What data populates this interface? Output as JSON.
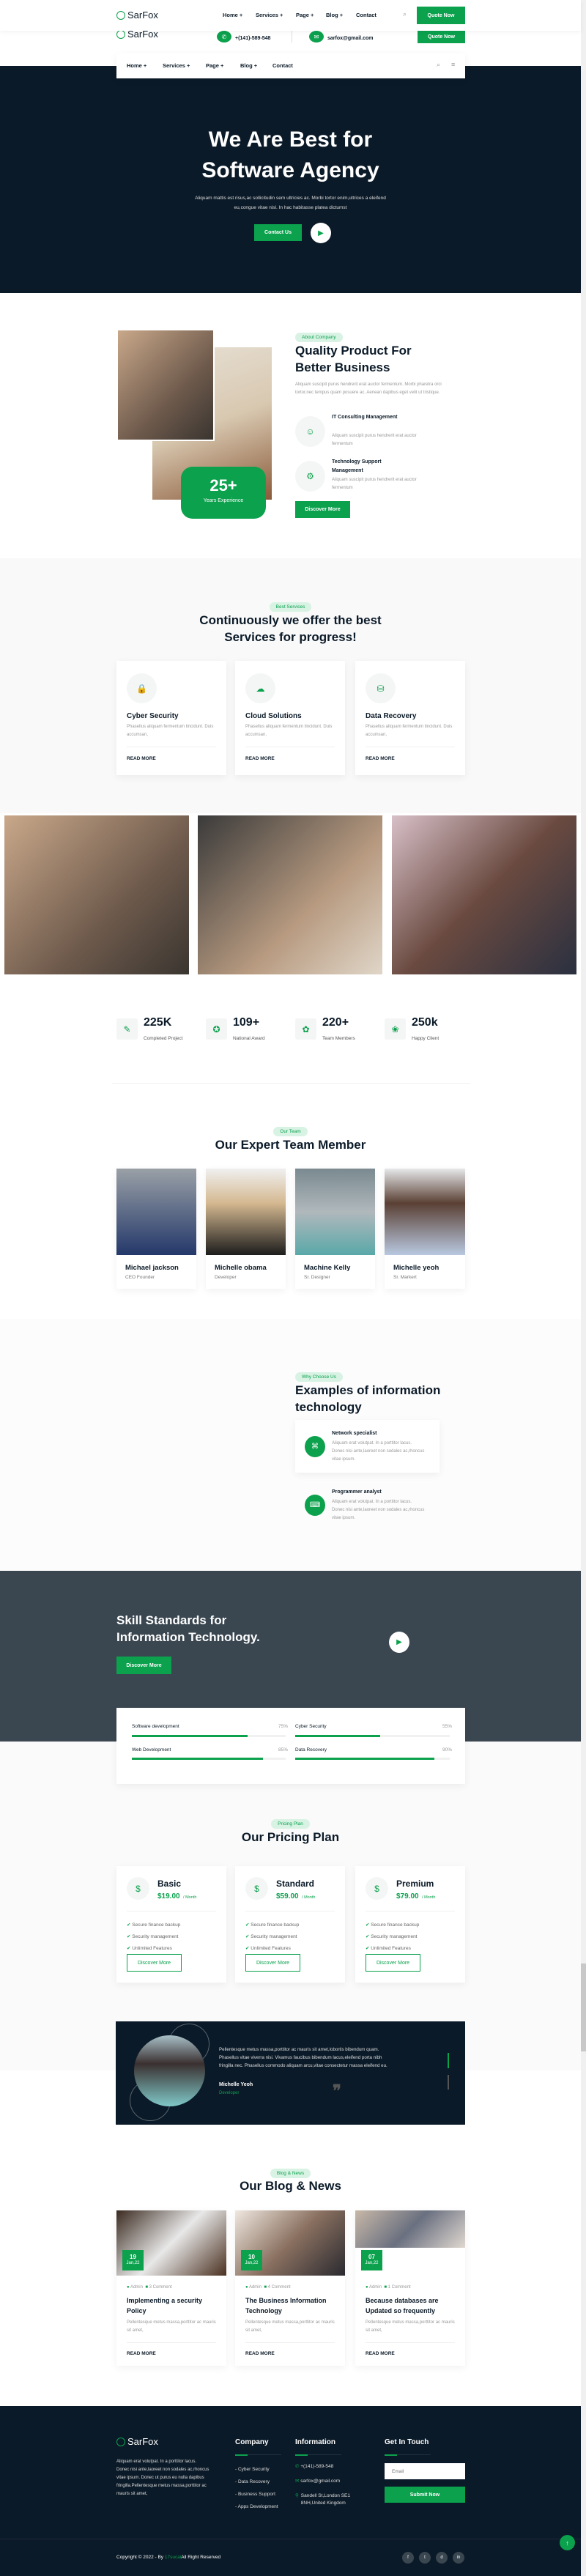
{
  "brand": "SarFox",
  "nav": [
    "Home +",
    "Services +",
    "Page +",
    "Blog +",
    "Contact"
  ],
  "quote_btn": "Quote Now",
  "contact": {
    "phone": "+(141)-589-548",
    "email": "sarfox@gmail.com"
  },
  "hero": {
    "title1": "We Are Best for",
    "title2": "Software Agency",
    "text1": "Aliquam mattis est risus,ac sollicitudin sem ultricies ac. Morbi tortor enim,ultrices a eleifend",
    "text2": "eu,congue vitae nisl. In hac habitasse platea dictumst",
    "cta": "Contact Us"
  },
  "about": {
    "tag": "About Company",
    "title1": "Quality Product For",
    "title2": "Better Business",
    "text": "Aliquam suscipit purus hendrerit erat auctor fermentum. Morbi pharetra orci tortor,nec tempus quam posuere ac. Aenean dapibus eget velit ut tristique.",
    "years": "25+",
    "years_label": "Years Experience",
    "items": [
      {
        "title": "IT Consulting Management",
        "text": "Aliquam suscipit purus hendrerit erat auctor fermentum"
      },
      {
        "title": "Technology Support Management",
        "text": "Aliquam suscipit purus hendrerit erat auctor fermentum"
      }
    ],
    "cta": "Discover More"
  },
  "services": {
    "tag": "Best Services",
    "title1": "Continuously we offer the best",
    "title2": "Services for progress!",
    "items": [
      {
        "title": "Cyber Security",
        "text": "Phasellus aliquam fermentum tincidunt. Duis accumsan,",
        "link": "READ MORE"
      },
      {
        "title": "Cloud Solutions",
        "text": "Phasellus aliquam fermentum tincidunt. Duis accumsan,",
        "link": "READ MORE"
      },
      {
        "title": "Data Recovery",
        "text": "Phasellus aliquam fermentum tincidunt. Duis accumsan,",
        "link": "READ MORE"
      }
    ]
  },
  "stats": [
    {
      "value": "225K",
      "label": "Completed Project"
    },
    {
      "value": "109+",
      "label": "National Award"
    },
    {
      "value": "220+",
      "label": "Team Members"
    },
    {
      "value": "250k",
      "label": "Happy Client"
    }
  ],
  "team": {
    "tag": "Our Team",
    "title": "Our Expert Team Member",
    "members": [
      {
        "name": "Michael jackson",
        "role": "CEO Founder"
      },
      {
        "name": "Michelle obama",
        "role": "Developer"
      },
      {
        "name": "Machine Kelly",
        "role": "Sr. Designer"
      },
      {
        "name": "Michelle yeoh",
        "role": "Sr. Markert"
      }
    ]
  },
  "why": {
    "tag": "Why Choose Us",
    "title1": "Examples of information",
    "title2": "technology",
    "items": [
      {
        "title": "Network specialist",
        "text": "Aliquam erat volutpat. In a porttitor lacus. Donec nisi ante,laoreet non sodales ac,rhoncus vitae ipsum."
      },
      {
        "title": "Programmer analyst",
        "text": "Aliquam erat volutpat. In a porttitor lacus. Donec nisi ante,laoreet non sodales ac,rhoncus vitae ipsum."
      }
    ]
  },
  "skills": {
    "title1": "Skill Standards for",
    "title2": "Information Technology.",
    "cta": "Discover More",
    "items": [
      {
        "label": "Software development",
        "value": 75,
        "text": "75%"
      },
      {
        "label": "Cyber Security",
        "value": 55,
        "text": "55%"
      },
      {
        "label": "Web Development",
        "value": 85,
        "text": "85%"
      },
      {
        "label": "Data Recovery",
        "value": 90,
        "text": "90%"
      }
    ]
  },
  "pricing": {
    "tag": "Pricing Plan",
    "title": "Our Pricing Plan",
    "per": "/ Month",
    "features": [
      "Secure finance backup",
      "Security management",
      "Unlimited Features"
    ],
    "cta": "Discover More",
    "plans": [
      {
        "name": "Basic",
        "price": "$19.00"
      },
      {
        "name": "Standard",
        "price": "$59.00"
      },
      {
        "name": "Premium",
        "price": "$79.00"
      }
    ]
  },
  "testimonial": {
    "text": "Pellentesque metus massa,porttitor ac mauris sit amet,lobortis bibendum quam. Phasellus vitae viverra nisi. Vivamus faucibus bibendum lacus,eleifend porta nibh fringilla nec. Phasellus commodo aliquam arcu,vitae consectetur massa eleifend eu.",
    "name": "Michelle Yeoh",
    "role": "Developer"
  },
  "blog": {
    "tag": "Blog & News",
    "title": "Our Blog & News",
    "author": "Admin",
    "text": "Pellentesque metus massa,porttitor ac mauris sit amet,",
    "link": "READ MORE",
    "posts": [
      {
        "day": "19",
        "month": "Jan,22",
        "comments": "3 Comment",
        "title": "Implementing a security Policy"
      },
      {
        "day": "10",
        "month": "Jan,22",
        "comments": "4 Comment",
        "title": "The Business Information Technology"
      },
      {
        "day": "07",
        "month": "Jan,22",
        "comments": "1 Comment",
        "title": "Because databases are Updated so frequently"
      }
    ]
  },
  "footer": {
    "about": "Aliquam erat volutpat. In a porttitor lacus. Donec nisi ante,laoreet non sodales ac,rhoncus vitae ipsum. Donec ut purus eu nulla dapibus fringilla.Pellentesque metus massa,porttitor ac mauris sit amet,",
    "company_title": "Company",
    "company": [
      "- Cyber Security",
      "- Data Recovery",
      "- Business Support",
      "- Apps Development"
    ],
    "info_title": "Information",
    "phone": "+(141)-589-548",
    "email": "sarfox@gmail.com",
    "address": "Sandell St,London SE1 8NH,United Kingdom",
    "touch_title": "Get In Touch",
    "email_placeholder": "Email",
    "submit": "Submit Now",
    "copy1": "Copyright © 2022 - By ",
    "copy_link": "17sucai",
    "copy2": "All Right Reserved",
    "social": [
      "f",
      "t",
      "d",
      "in"
    ]
  },
  "colors": {
    "accent": "#0ba14d",
    "dark": "#0b1a28",
    "slate": "#3a4650"
  }
}
